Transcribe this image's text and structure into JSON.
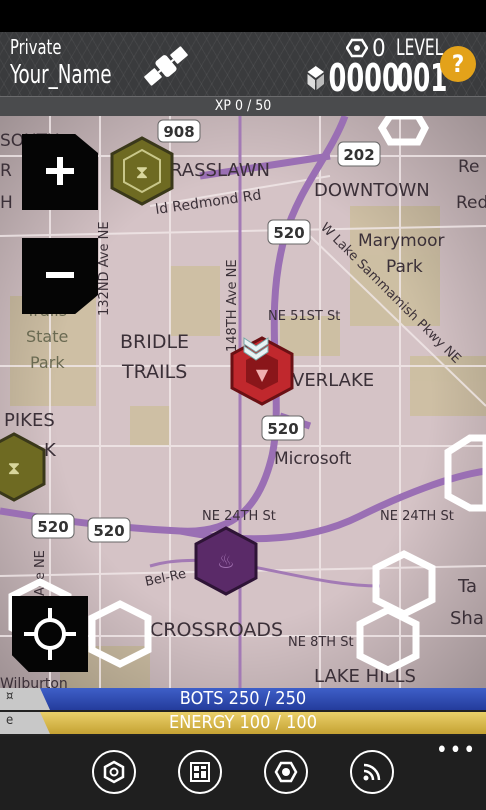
{
  "header": {
    "rank": "Private",
    "username": "Your_Name",
    "gems": "0",
    "cubes": "0000",
    "level_label": "LEVEL",
    "level_value": "001",
    "help": "?"
  },
  "xp": {
    "label": "XP 0 / 50"
  },
  "map": {
    "labels": {
      "south": "SOUTH",
      "r": "R",
      "h": "H",
      "grasslawn": "RASSLAWN",
      "downtown": "DOWNTOWN",
      "redmond_rd": "ld Redmond Rd",
      "marymoor1": "Marymoor",
      "marymoor2": "Park",
      "lake_samm": "W Lake Sammamish Pkwy NE",
      "ne51": "NE 51ST St",
      "ave148": "148TH Ave NE",
      "ave132": "132ND Ave NE",
      "bridle1": "BRIDLE",
      "bridle2": "TRAILS",
      "trails1": "Trails",
      "trails2": "State",
      "trails3": "Park",
      "pikes": "PIKES",
      "k": "K",
      "overlake": "VERLAKE",
      "microsoft": "Microsoft",
      "ne24_1": "NE 24TH St",
      "ne24_2": "NE 24TH St",
      "belre": "Bel-Re",
      "crossroads": "CROSSROADS",
      "ne8": "NE 8TH St",
      "lakehills": "LAKE HILLS",
      "wilburton": "Wilburton",
      "ave_ne": "Ave NE",
      "ta": "Ta",
      "sha": "Sha",
      "reg1": "Re",
      "reg2": "Red"
    },
    "shields": [
      "908",
      "202",
      "520",
      "520",
      "520",
      "520"
    ]
  },
  "stats": {
    "bots": "BOTS  250 / 250",
    "energy": "ENERGY  100 / 100",
    "bots_icon": "¤",
    "energy_icon": "e"
  },
  "appbar": {
    "more": "•••"
  },
  "colors": {
    "bots": "#2f4db3",
    "energy": "#d8b84b",
    "help": "#e3a21a",
    "red_portal": "#c0282d",
    "green_portal": "#6e6a22",
    "purple_portal": "#5a2a68"
  }
}
